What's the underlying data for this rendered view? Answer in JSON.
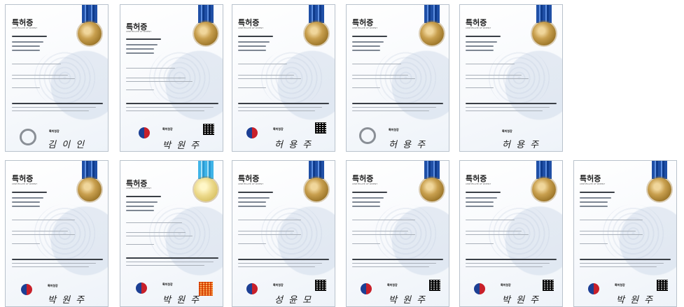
{
  "title": "특허증",
  "subtitle": "CERTIFICATE OF PATENT",
  "office": "특허청장",
  "signature_names": [
    "김 이 인",
    "박 원 주",
    "허 용 주",
    "허 용 주",
    "허 용 주",
    "박 원 주",
    "박 원 주",
    "성 윤 모",
    "박 원 주",
    "박 원 주"
  ],
  "colors": {
    "ribbon": "#1f4fa6",
    "seal_gold": "#c89f4e",
    "border": "#b9c2cc"
  }
}
